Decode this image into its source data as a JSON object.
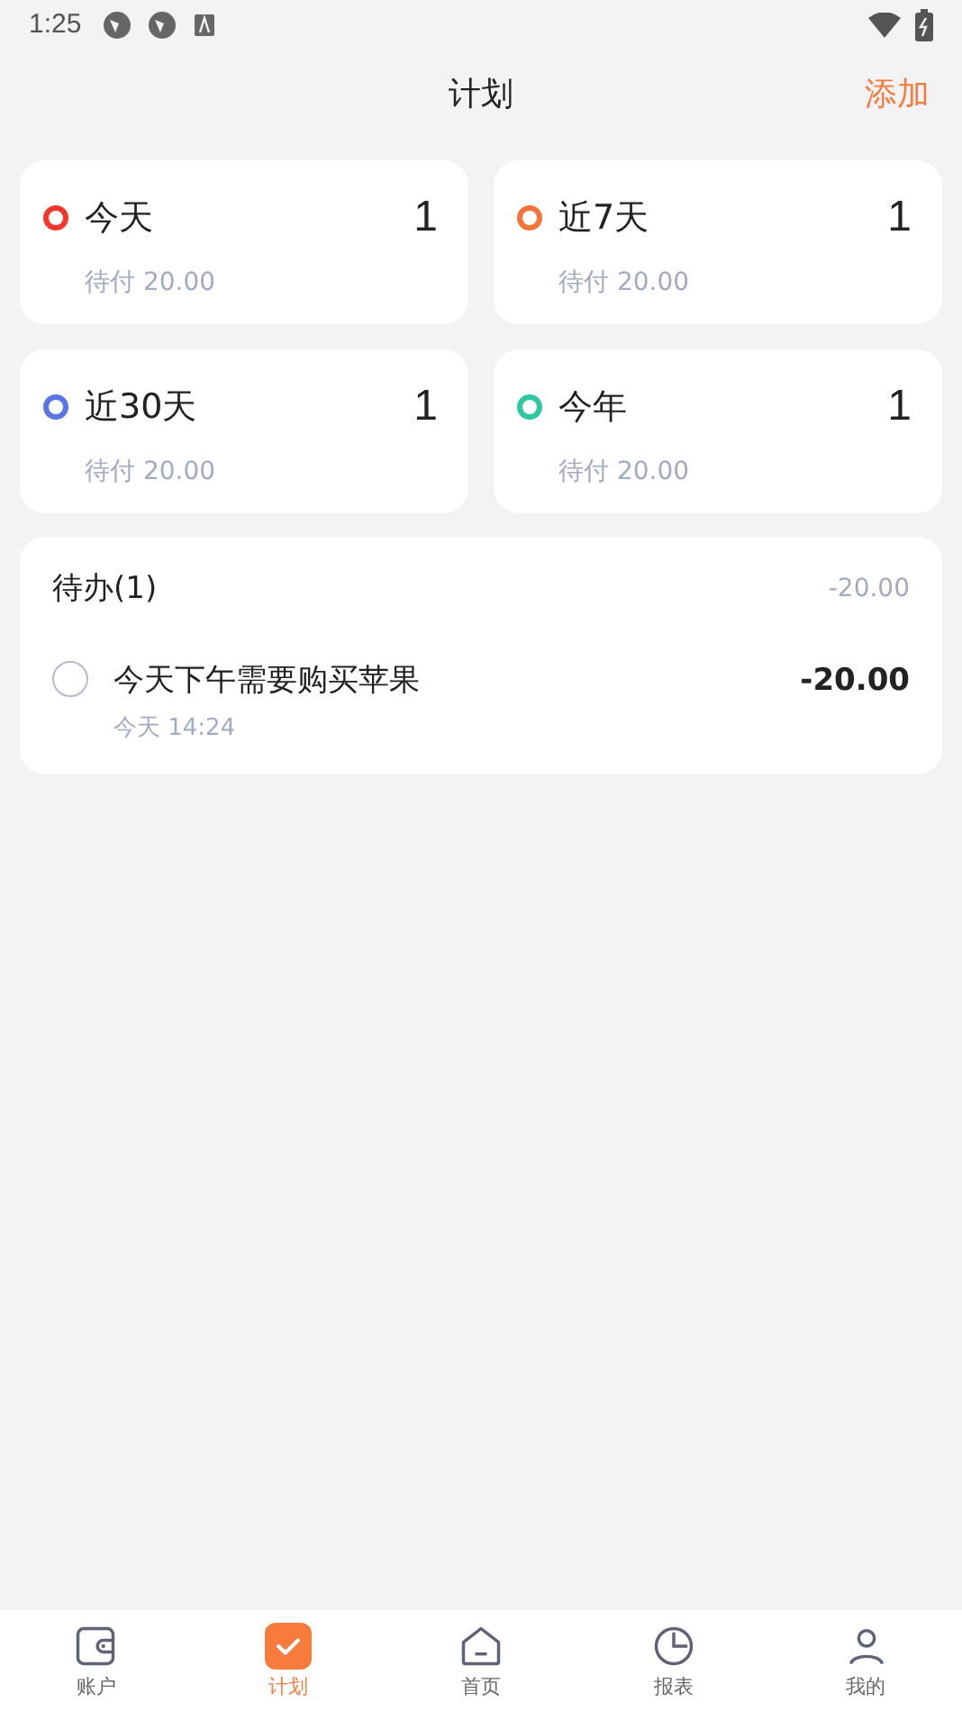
{
  "status_bar": {
    "time": "1:25"
  },
  "header": {
    "title": "计划",
    "action": "添加"
  },
  "summary_cards": [
    {
      "label": "今天",
      "count": "1",
      "pending": "待付 20.00",
      "color": "#f5362c"
    },
    {
      "label": "近7天",
      "count": "1",
      "pending": "待付 20.00",
      "color": "#f6743a"
    },
    {
      "label": "近30天",
      "count": "1",
      "pending": "待付 20.00",
      "color": "#5b74e8"
    },
    {
      "label": "今年",
      "count": "1",
      "pending": "待付 20.00",
      "color": "#2ec7a0"
    }
  ],
  "todo": {
    "title": "待办(1)",
    "total": "-20.00",
    "items": [
      {
        "title": "今天下午需要购买苹果",
        "time": "今天 14:24",
        "amount": "-20.00",
        "checked": false
      }
    ]
  },
  "tab_bar": [
    {
      "kind": "wallet",
      "label": "账户",
      "selected": false
    },
    {
      "kind": "plan",
      "label": "计划",
      "selected": true
    },
    {
      "kind": "home",
      "label": "首页",
      "selected": false
    },
    {
      "kind": "report",
      "label": "报表",
      "selected": false
    },
    {
      "kind": "profile",
      "label": "我的",
      "selected": false
    }
  ]
}
